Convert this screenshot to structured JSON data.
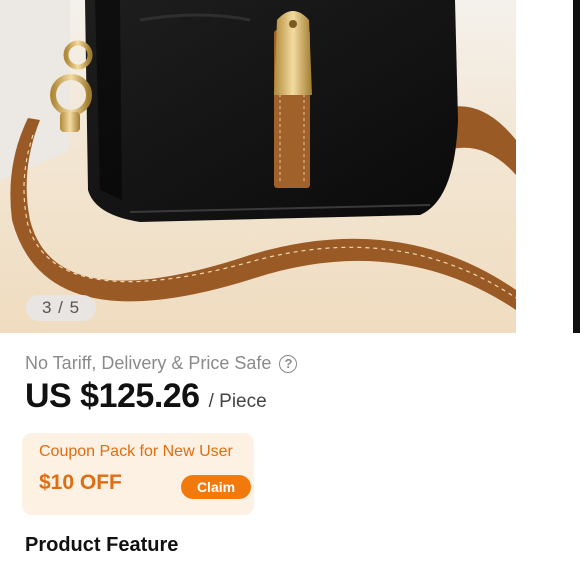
{
  "gallery": {
    "counter": "3 / 5",
    "image_alt": "Black leather crossbody bag with brown strap"
  },
  "product": {
    "notice": "No Tariff, Delivery & Price Safe",
    "help_icon": "question-circle-icon",
    "price": "US $125.26",
    "unit": "/ Piece"
  },
  "coupon": {
    "title": "Coupon Pack for New User",
    "amount": "$10 OFF",
    "claim_label": "Claim"
  },
  "sections": {
    "feature_title": "Product Feature"
  },
  "colors": {
    "accent": "#f27a0c",
    "coupon_bg": "#fdf1e3",
    "coupon_text": "#e06d10"
  }
}
